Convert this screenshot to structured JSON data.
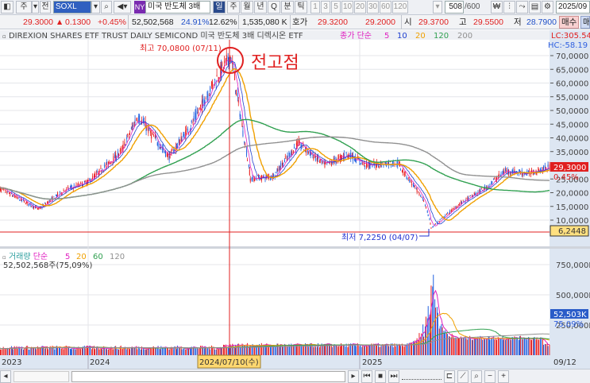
{
  "toolbar": {
    "period_select": "주",
    "all_button": "전",
    "symbol": "SOXL",
    "exchange_badge": "NY",
    "name": "미국 반도체 3배",
    "periods": [
      "일",
      "주",
      "월",
      "년",
      "Q",
      "분",
      "틱"
    ],
    "active_period": "일",
    "intervals": [
      "1",
      "3",
      "5",
      "10",
      "20",
      "30",
      "60",
      "120"
    ],
    "count": "508",
    "max_count": "/600",
    "date": "2025/09"
  },
  "quote": {
    "price": "29.3000",
    "arrow": "▲",
    "change": "0.1300",
    "change_pct": "+0.45%",
    "volume": "52,502,568",
    "ratio1": "24.91%",
    "ratio2": "12.62%",
    "amount": "1,535,080 K",
    "bid_label": "호가",
    "ask": "29.3200",
    "bid": "29.2000",
    "open_label": "시",
    "open": "29.3700",
    "high_label": "고",
    "high": "29.5500",
    "low_label": "저",
    "low": "28.7900",
    "buy": "매수",
    "sell": "매"
  },
  "price_panel": {
    "title": "DIREXION SHARES ETF TRUST DAILY SEMICOND  미국 반도체 3배 디렉시온 ETF",
    "legend_prefix": "종가 단순",
    "ma": [
      {
        "label": "5",
        "color": "#e020c0"
      },
      {
        "label": "10",
        "color": "#2040d0"
      },
      {
        "label": "20",
        "color": "#f0a000"
      },
      {
        "label": "120",
        "color": "#30a050"
      },
      {
        "label": "200",
        "color": "#909090"
      }
    ],
    "lc": "LC:305.54",
    "hc": "HC:-58.19",
    "y_ticks": [
      "70,0000",
      "65,0000",
      "60,0000",
      "55,0000",
      "50,0000",
      "45,0000",
      "40,0000",
      "35,0000",
      "30,0000",
      "25,0000",
      "20,0000",
      "15,0000",
      "10,0000"
    ],
    "last_price_tag": "29,3000",
    "last_pct_tag": "0,45%",
    "line_tag": "6,2448",
    "high_note": "최고 70,0800 (07/11)",
    "low_note": "최저 7,2250 (04/07)",
    "user_annotation": "전고점"
  },
  "volume_panel": {
    "title": "거래량",
    "legend_prefix": "단순",
    "ma": [
      {
        "label": "5",
        "color": "#e020c0"
      },
      {
        "label": "20",
        "color": "#f0a000"
      },
      {
        "label": "60",
        "color": "#30a050"
      },
      {
        "label": "120",
        "color": "#909090"
      }
    ],
    "info": "52,502,568주(75,09%)",
    "y_ticks": [
      "750,000K",
      "500,000K",
      "250,000K"
    ],
    "last_tag": "52,503K",
    "last_pct": "75,09%"
  },
  "x_axis": {
    "labels": [
      "2023",
      "2024",
      "2025"
    ],
    "cursor_label": "2024/07/10(수)",
    "end_label": "09/12"
  },
  "colors": {
    "up": "#e82020",
    "down": "#2060e0",
    "accent": "#2a4a8c"
  },
  "chart_data": {
    "type": "candlestick",
    "symbol": "SOXL",
    "y_range": [
      5,
      75
    ],
    "keypoints": [
      [
        "2023-09-01",
        22
      ],
      [
        "2023-10-27",
        14
      ],
      [
        "2023-12-01",
        21
      ],
      [
        "2024-01-02",
        24
      ],
      [
        "2024-02-15",
        35
      ],
      [
        "2024-03-08",
        48
      ],
      [
        "2024-04-19",
        33
      ],
      [
        "2024-05-20",
        45
      ],
      [
        "2024-06-18",
        60
      ],
      [
        "2024-07-11",
        70.08
      ],
      [
        "2024-08-07",
        25
      ],
      [
        "2024-09-06",
        26
      ],
      [
        "2024-10-10",
        38
      ],
      [
        "2024-11-15",
        30
      ],
      [
        "2024-12-16",
        34
      ],
      [
        "2025-01-10",
        30
      ],
      [
        "2025-02-20",
        31
      ],
      [
        "2025-03-28",
        17
      ],
      [
        "2025-04-07",
        7.225
      ],
      [
        "2025-05-15",
        16
      ],
      [
        "2025-06-20",
        22
      ],
      [
        "2025-07-15",
        28
      ],
      [
        "2025-08-15",
        27
      ],
      [
        "2025-09-12",
        29.3
      ]
    ],
    "volume_range": [
      0,
      750000000
    ],
    "volume_peak_date": "2025-04-07",
    "volume_peak": 760000000
  }
}
